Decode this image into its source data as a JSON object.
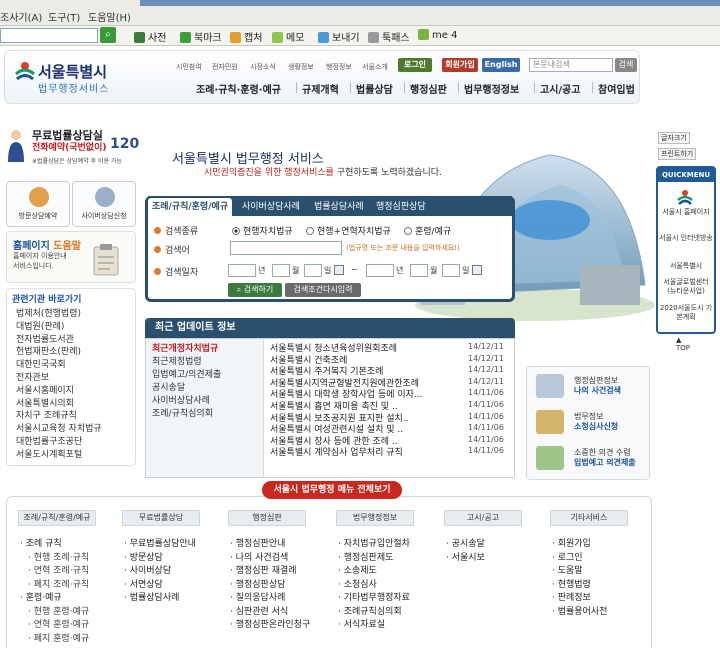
{
  "browser": {
    "menu": [
      "조사기(A)",
      "도구(T)",
      "도움말(H)"
    ],
    "toolbar": [
      "사전",
      "북마크",
      "캡처",
      "메모",
      "보내기",
      "툭패스",
      "me 4"
    ]
  },
  "header": {
    "logo_title": "서울특별시",
    "logo_sub": "법무행정서비스",
    "util_links": [
      "시민참여",
      "전자민원",
      "시정소식",
      "생활정보",
      "행정정보",
      "서울소개"
    ],
    "login": "로그인",
    "join": "회원가입",
    "english": "English",
    "search_placeholder": "본문내검색",
    "search_button": "검색",
    "gnav": [
      "조례·규칙·훈령·예규",
      "규제개혁",
      "법률상담",
      "행정심판",
      "법무행정정보",
      "고시/공고",
      "참여입법"
    ]
  },
  "left": {
    "consult_title": "무료법률상담실",
    "consult_phone_label": "전화예약(국번없이)",
    "consult_phone": "120",
    "consult_note": "※법률상담은 상담예약 후 이용 가능",
    "btn_visit": "방문상담예약",
    "btn_cyber": "사이버상담신청",
    "home_title_a": "홈페이지 ",
    "home_title_b": "도움말",
    "home_desc": "홈페이지 이용안내 서비스입니다.",
    "related_title": "관련기관 바로가기",
    "related": [
      "법제처(현행법령)",
      "대법원(판례)",
      "전자법률도서관",
      "헌법재판소(판례)",
      "대한민국국회",
      "전자관보",
      "서울시홈페이지",
      "서울특별시의회",
      "자치구 조례규칙",
      "서울시교육청 자치법규",
      "대한법률구조공단",
      "서울도시계획포털"
    ]
  },
  "banner": {
    "line1": "서울특별시 법무행정 서비스",
    "line2_a": "시민권익증진을 위한 행정서비스를",
    "line2_b": " 구현하도록 노력하겠습니다."
  },
  "right": {
    "font_size": "글자크기",
    "print": "프린트하기",
    "quick_title": "QUICKMENU",
    "quick": [
      "서울시 홈페이지",
      "서울시 인터넷방송",
      "서울특별시",
      "서울글로벌센터 (뉴타운사업)",
      "2020서울도시 기본계획"
    ],
    "top": "TOP"
  },
  "search": {
    "tabs": [
      "조례/규칙/훈령/예규",
      "사이버상담사례",
      "법률상담사례",
      "행정심판상담"
    ],
    "label_type": "검색종류",
    "label_word": "검색어",
    "label_date": "검색일자",
    "radios": [
      "현행자치법규",
      "현행+연혁자치법규",
      "훈령/예규"
    ],
    "hint": "(법규명 또는 조문 내용을 입력하세요!)",
    "year": "년",
    "month": "월",
    "day": "일",
    "tilde": "~",
    "btn_search": "검색하기",
    "btn_reset": "검색조건다시입력"
  },
  "recent": {
    "title": "최근 업데이트 정보",
    "categories": [
      "최근개정자치법규",
      "최근제정법령",
      "입법예고/의견제출",
      "공시송달",
      "사이버상담사례",
      "조례/규칙심의회"
    ],
    "items": [
      {
        "t": "서울특별시 청소년육성위원회조례",
        "d": "14/12/11"
      },
      {
        "t": "서울특별시 건축조례",
        "d": "14/12/11"
      },
      {
        "t": "서울특별시 주거복지 기본조례",
        "d": "14/12/11"
      },
      {
        "t": "서울특별시지역균형발전지원에관한조례",
        "d": "14/12/11"
      },
      {
        "t": "서울특별시 대학생 장학사업 등에 이자...",
        "d": "14/11/06"
      },
      {
        "t": "서울특별시 흡연 재미용 촉진 및 ..",
        "d": "14/11/06"
      },
      {
        "t": "서울특별시 보조공지원 표지판 설치..",
        "d": "14/11/06"
      },
      {
        "t": "서울특별시 여성관련시설 설치 및 ..",
        "d": "14/11/06"
      },
      {
        "t": "서울특별시 장사 등에 관한 조례 ..",
        "d": "14/11/06"
      },
      {
        "t": "서울특별시 계약심사 업무처리 규칙",
        "d": "14/11/06"
      }
    ]
  },
  "rbanners": [
    {
      "a": "행정심판정보",
      "b": "나의 사건검색"
    },
    {
      "a": "법무정보",
      "b": "소청심사신청"
    },
    {
      "a": "소중한 의견 수렴",
      "b": "입법예고 의견제출"
    }
  ],
  "sitemap": {
    "button": "서울시 법무행정 메뉴 전체보기",
    "cols": [
      {
        "h": "조례/규칙/훈령/예규",
        "items": [
          "조례 규칙",
          "현행 조례·규칙",
          "연혁 조례·규칙",
          "폐지 조례·규칙",
          "훈령·예규",
          "현행 훈령·예규",
          "연혁 훈령·예규",
          "폐지 훈령·예규"
        ]
      },
      {
        "h": "무료법률상담",
        "items": [
          "무료법률상담안내",
          "방문상담",
          "사이버상담",
          "서면상담",
          "법률상담사례"
        ]
      },
      {
        "h": "행정심판",
        "items": [
          "행정심판안내",
          "나의 사건검색",
          "행정심판 재결례",
          "행정심판상담",
          "질의응답사례",
          "심판관련 서식",
          "행정심판온라인청구"
        ]
      },
      {
        "h": "법무행정정보",
        "items": [
          "자치법규입안절차",
          "행정심판제도",
          "소송제도",
          "소청심사",
          "기타법무행정자료",
          "조례규칙심의회",
          "서식자료실"
        ]
      },
      {
        "h": "고시/공고",
        "items": [
          "공시송달",
          "서울시보"
        ]
      },
      {
        "h": "기타서비스",
        "items": [
          "회원가입",
          "로그인",
          "도움말",
          "현행법령",
          "판례정보",
          "법률용어사전"
        ]
      }
    ]
  }
}
